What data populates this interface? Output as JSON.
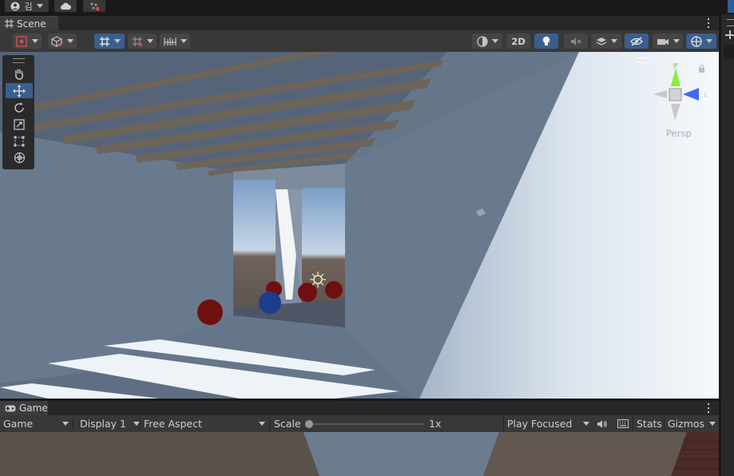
{
  "topbar": {
    "account_label": "김"
  },
  "scene": {
    "tab_label": "Scene",
    "toggle_2d_label": "2D",
    "camera_label": "Persp"
  },
  "game": {
    "tab_label": "Game",
    "view_dropdown": "Game",
    "display_dropdown": "Display 1",
    "aspect_dropdown": "Free Aspect",
    "scale_label": "Scale",
    "scale_value_label": "1x",
    "scale_value": 0.0,
    "play_mode_dropdown": "Play Focused",
    "stats_label": "Stats",
    "gizmos_label": "Gizmos"
  },
  "colors": {
    "accent_blue": "#3a5f8f",
    "gizmo_y": "#8ced3d",
    "gizmo_z": "#3f6bf5",
    "sphere_red": "#6e1010",
    "sphere_blue": "#1b3d8c"
  }
}
